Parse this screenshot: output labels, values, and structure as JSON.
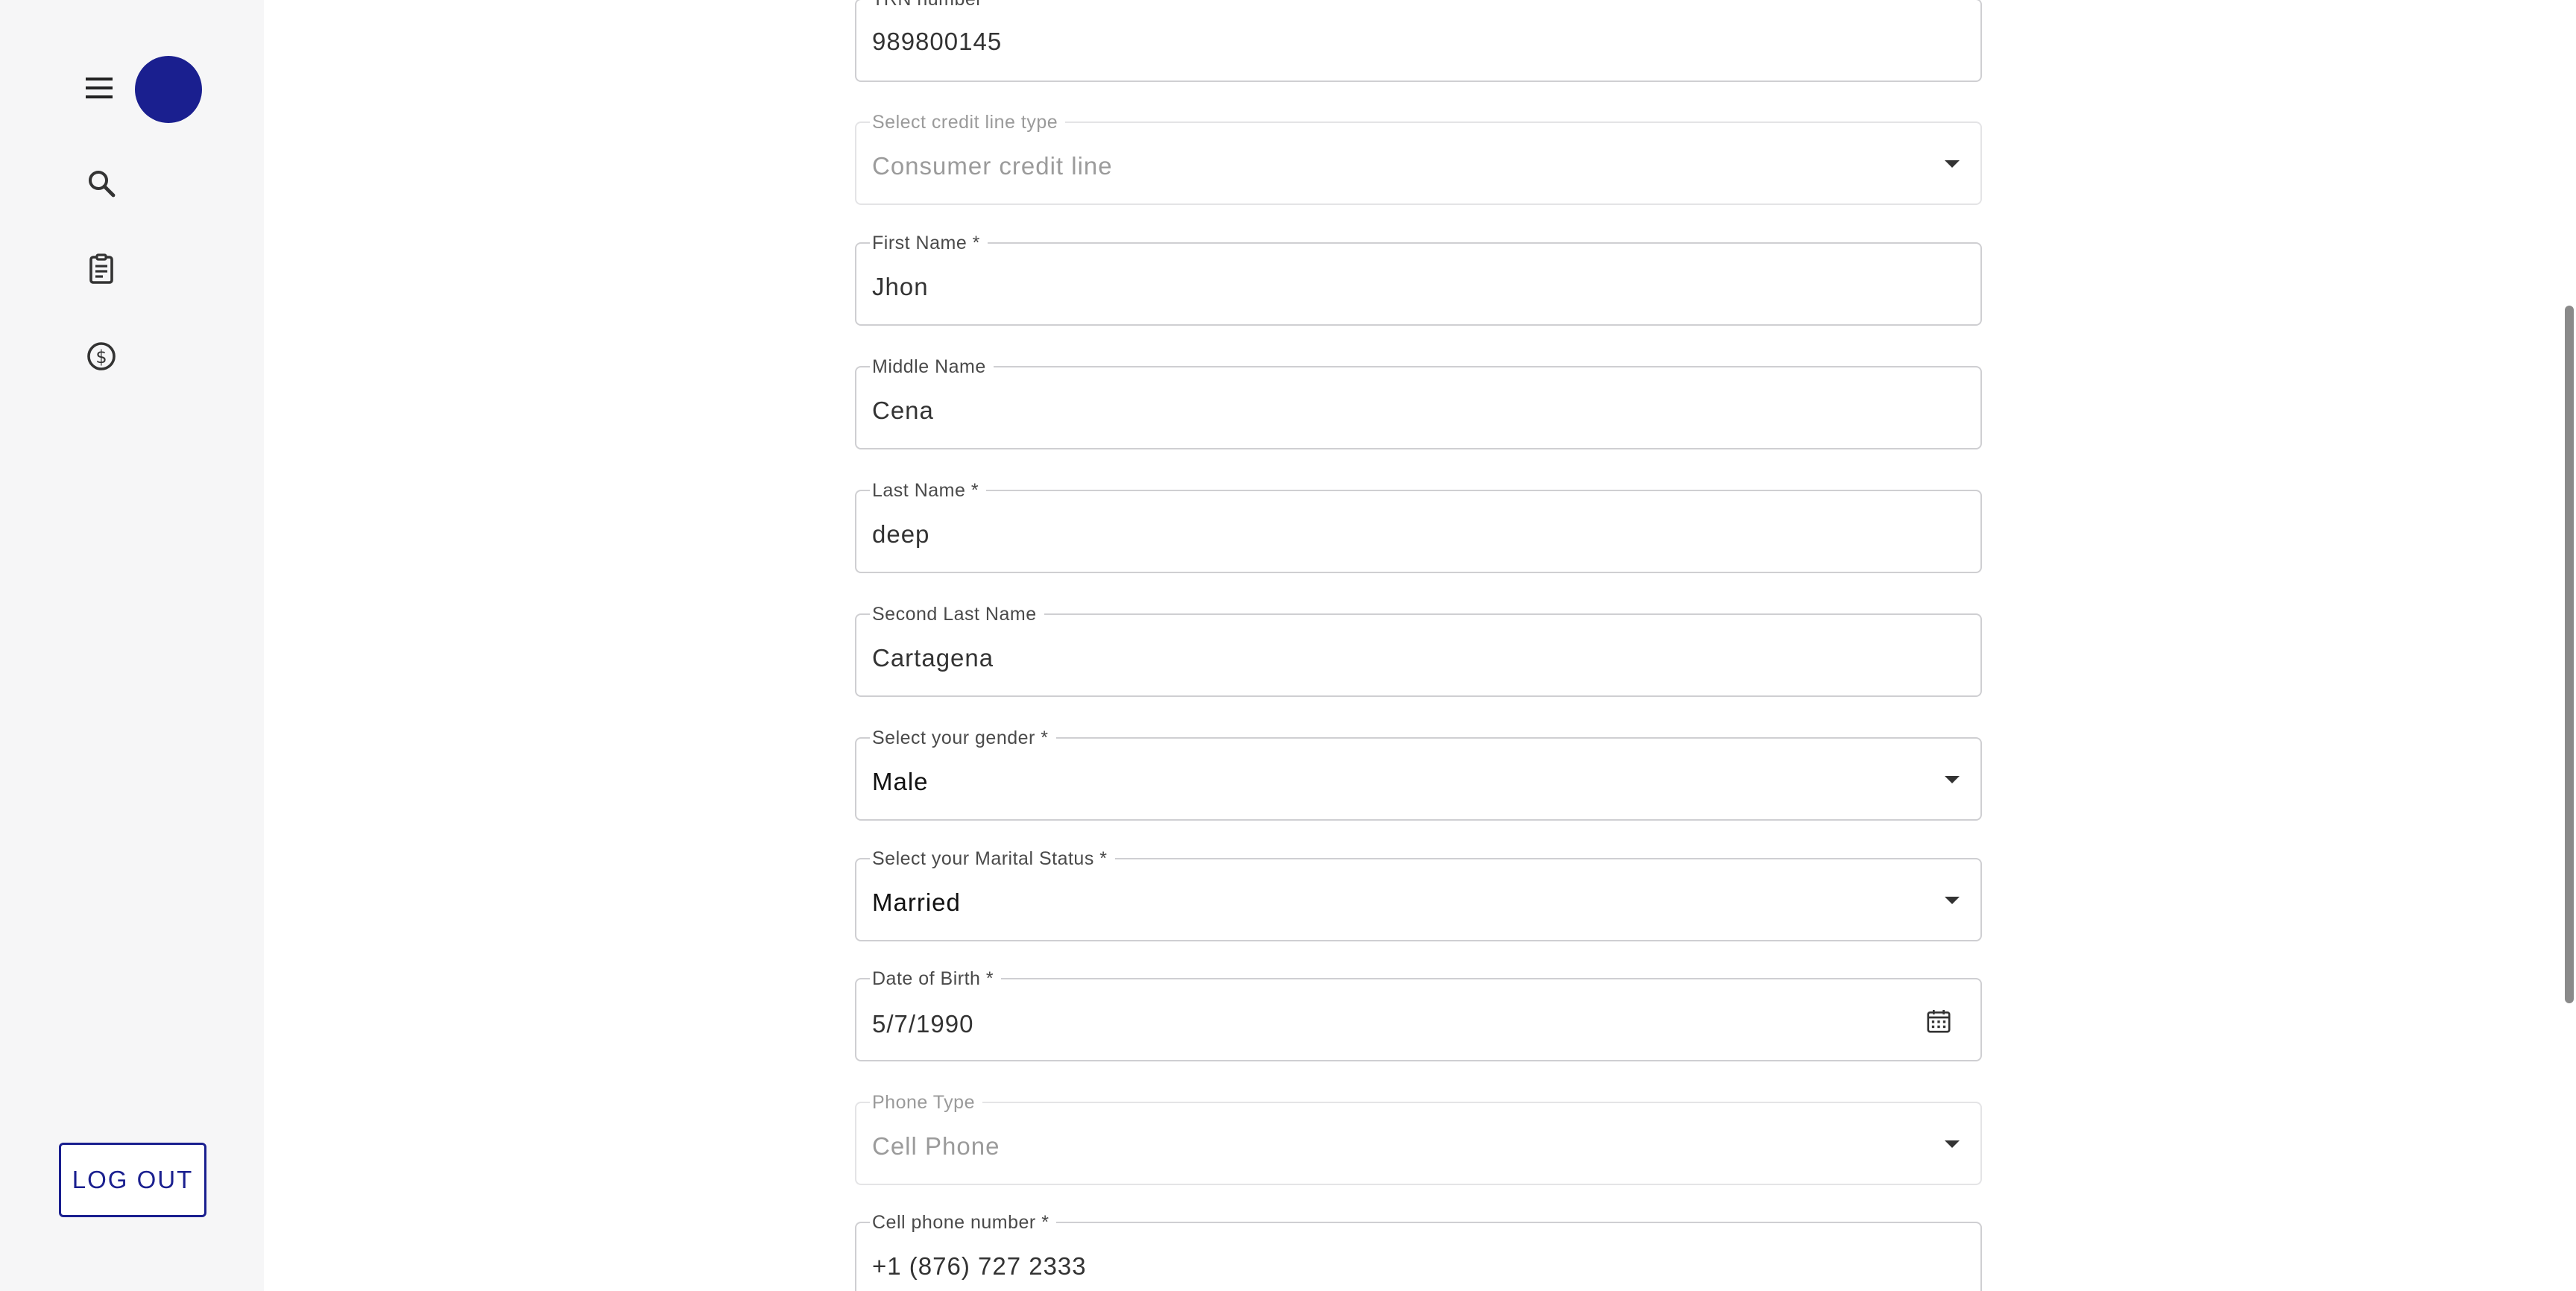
{
  "sidebar": {
    "icons": [
      "menu-icon",
      "avatar",
      "search-icon",
      "clipboard-icon",
      "dollar-icon"
    ],
    "logout_label": "LOG OUT"
  },
  "colors": {
    "accent": "#1a1f8f",
    "sidebar_bg": "#f6f6f7",
    "border": "#cfcfd2"
  },
  "form": {
    "trn": {
      "label": "TRN number",
      "value": "989800145"
    },
    "credit_line": {
      "label": "Select credit line type",
      "value": "Consumer credit line"
    },
    "first_name": {
      "label": "First Name *",
      "value": "Jhon"
    },
    "middle_name": {
      "label": "Middle Name",
      "value": "Cena"
    },
    "last_name": {
      "label": "Last Name *",
      "value": "deep"
    },
    "second_last_name": {
      "label": "Second Last Name",
      "value": "Cartagena"
    },
    "gender": {
      "label": "Select your gender *",
      "value": "Male"
    },
    "marital_status": {
      "label": "Select your Marital Status *",
      "value": "Married"
    },
    "dob": {
      "label": "Date of Birth *",
      "value": "5/7/1990"
    },
    "phone_type": {
      "label": "Phone Type",
      "value": "Cell Phone"
    },
    "cell_phone": {
      "label": "Cell phone number *",
      "value": "+1 (876) 727 2333"
    }
  }
}
